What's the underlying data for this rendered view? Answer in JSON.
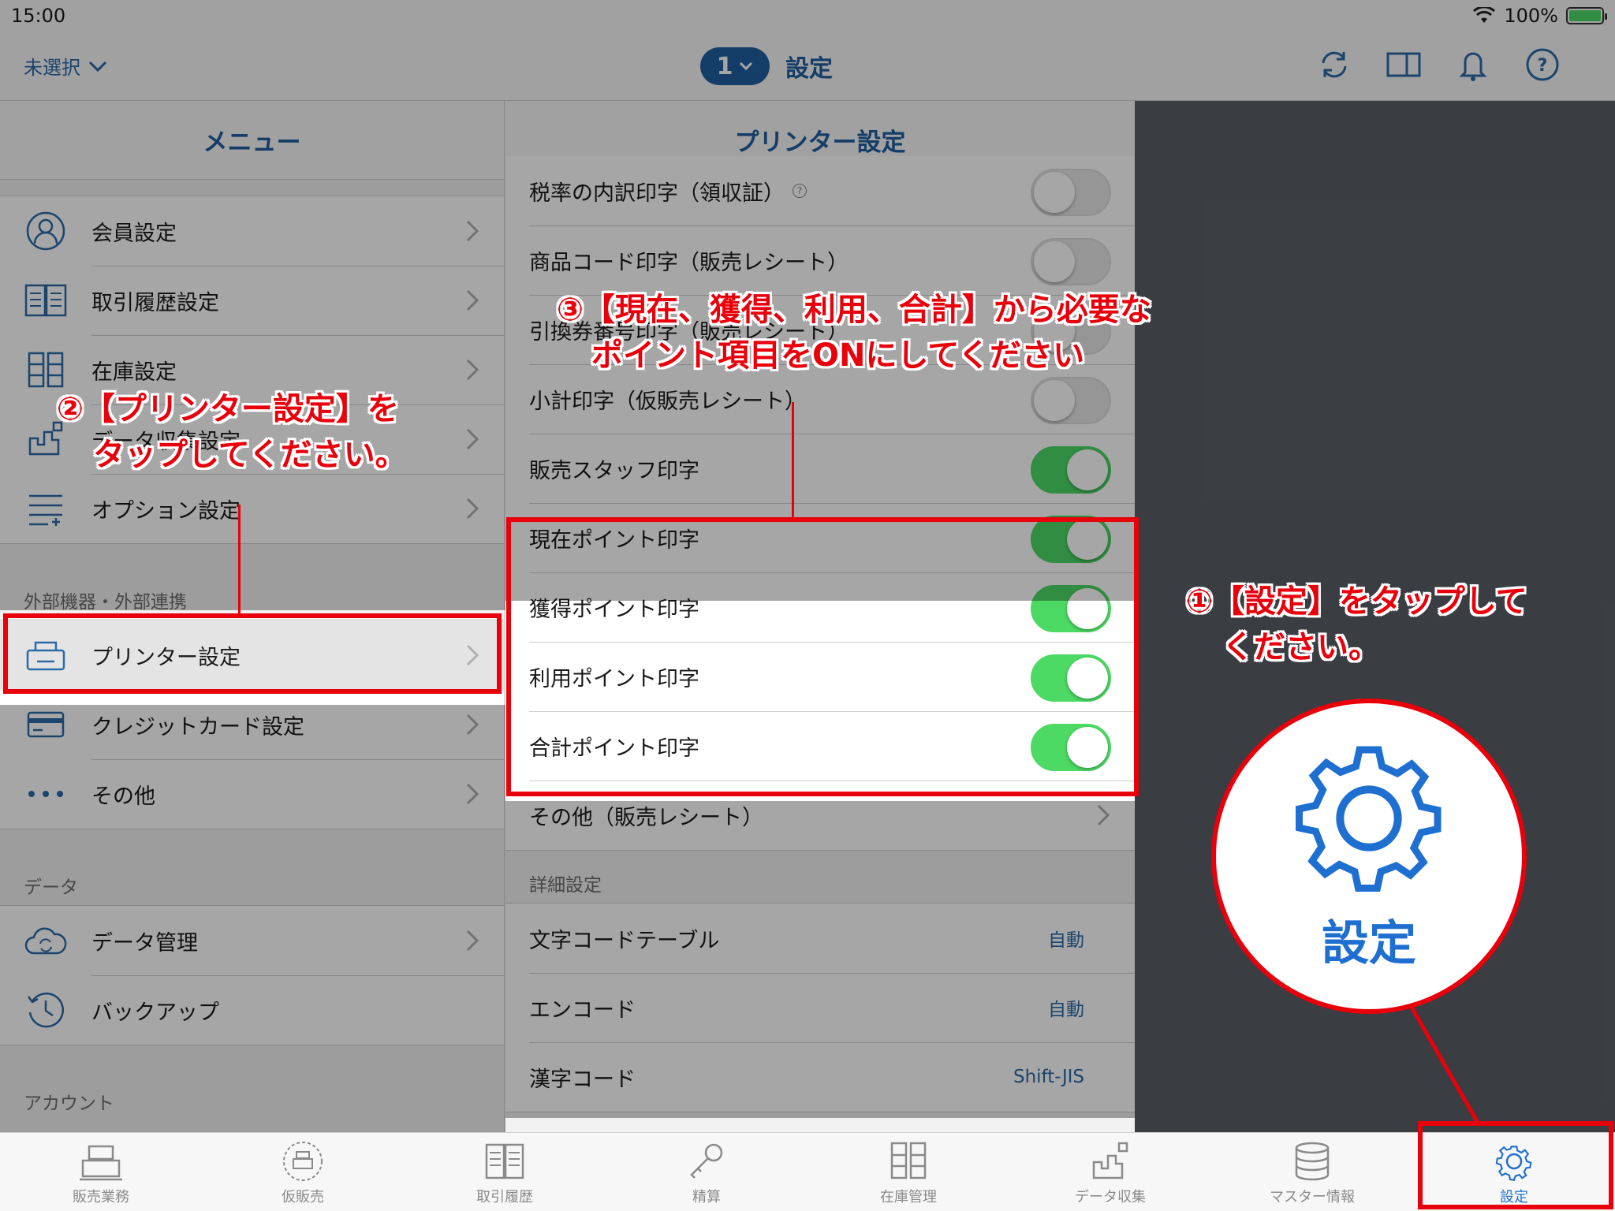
{
  "status": {
    "time": "15:00",
    "battery": "100%"
  },
  "nav": {
    "left_label": "未選択",
    "pill_number": "1",
    "title": "設定",
    "icons": [
      "refresh-icon",
      "split-view-icon",
      "bell-icon",
      "help-icon"
    ]
  },
  "menu": {
    "header": "メニュー",
    "items_top": [
      {
        "label": "会員設定",
        "icon": "person-icon"
      },
      {
        "label": "取引履歴設定",
        "icon": "book-icon"
      },
      {
        "label": "在庫設定",
        "icon": "shelf-icon"
      },
      {
        "label": "データ収集設定",
        "icon": "data-collect-icon"
      },
      {
        "label": "オプション設定",
        "icon": "option-list-icon"
      }
    ],
    "section_external": "外部機器・外部連携",
    "items_external": [
      {
        "label": "プリンター設定",
        "icon": "printer-icon"
      },
      {
        "label": "クレジットカード設定",
        "icon": "credit-card-icon"
      },
      {
        "label": "その他",
        "icon": "more-dots-icon"
      }
    ],
    "section_data": "データ",
    "items_data": [
      {
        "label": "データ管理",
        "icon": "cloud-sync-icon"
      },
      {
        "label": "バックアップ",
        "icon": "history-clock-icon"
      }
    ],
    "section_account": "アカウント"
  },
  "detail": {
    "header": "プリンター設定",
    "rows_top": [
      {
        "label": "税率の内訳印字（領収証）",
        "toggle": "off",
        "help": "?"
      },
      {
        "label": "商品コード印字（販売レシート）",
        "toggle": "off"
      },
      {
        "label": "引換券番号印字（販売レシート）",
        "toggle": "off"
      },
      {
        "label": "小計印字（仮販売レシート）",
        "toggle": "off"
      },
      {
        "label": "販売スタッフ印字",
        "toggle": "on"
      }
    ],
    "rows_points": [
      {
        "label": "現在ポイント印字",
        "toggle": "on"
      },
      {
        "label": "獲得ポイント印字",
        "toggle": "on"
      },
      {
        "label": "利用ポイント印字",
        "toggle": "on"
      },
      {
        "label": "合計ポイント印字",
        "toggle": "on"
      }
    ],
    "row_other": "その他（販売レシート）",
    "section_detail": "詳細設定",
    "rows_detail": [
      {
        "label": "文字コードテーブル",
        "value": "自動"
      },
      {
        "label": "エンコード",
        "value": "自動"
      },
      {
        "label": "漢字コード",
        "value": "Shift-JIS"
      }
    ]
  },
  "tabs": [
    {
      "label": "販売業務",
      "icon": "register-icon"
    },
    {
      "label": "仮販売",
      "icon": "temp-sale-icon"
    },
    {
      "label": "取引履歴",
      "icon": "history-book-icon"
    },
    {
      "label": "精算",
      "icon": "key-icon"
    },
    {
      "label": "在庫管理",
      "icon": "inventory-icon"
    },
    {
      "label": "データ収集",
      "icon": "data-collect-icon"
    },
    {
      "label": "マスター情報",
      "icon": "database-icon"
    },
    {
      "label": "設定",
      "icon": "gear-icon",
      "active": true
    }
  ],
  "annotations": {
    "step1_line1": "①【設定】をタップして",
    "step1_line2": "ください。",
    "step2_line1": "②【プリンター設定】を",
    "step2_line2": "タップしてください。",
    "step3_line1": "③【現在、獲得、利用、合計】から必要な",
    "step3_line2": "ポイント項目をONにしてください",
    "zoom_label": "設定"
  },
  "colors": {
    "accent": "#1f5f9e",
    "toggle_on": "#4cd964",
    "annotation": "#e8000b"
  }
}
